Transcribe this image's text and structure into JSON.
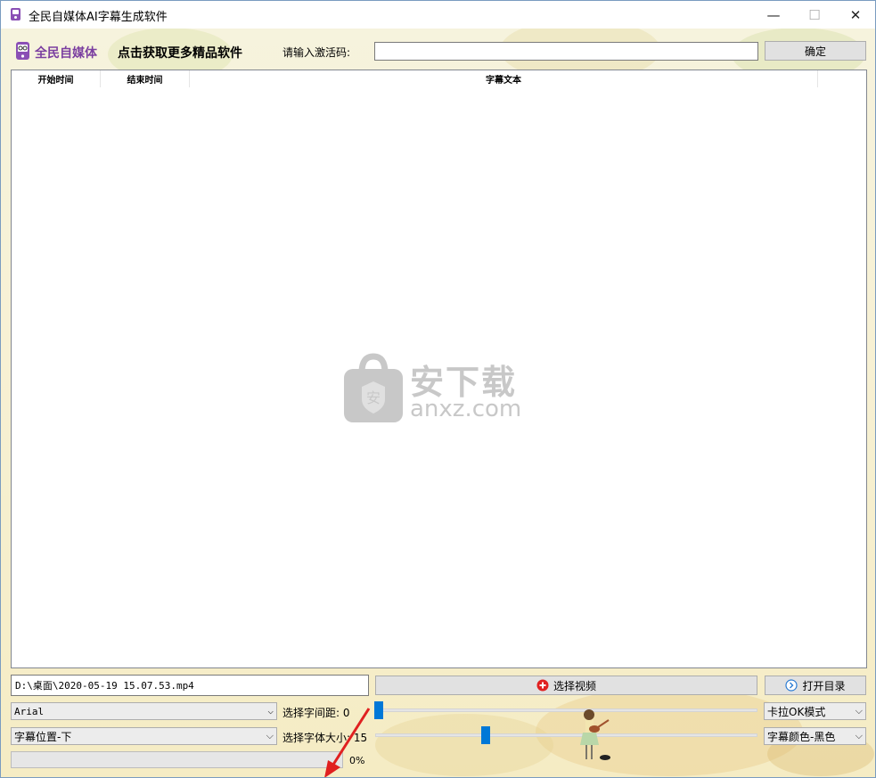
{
  "window": {
    "title": "全民自媒体AI字幕生成软件",
    "controls": {
      "minimize": "—",
      "maximize": "☐",
      "close": "✕"
    }
  },
  "header": {
    "brand": "全民自媒体",
    "promo_link": "点击获取更多精品软件",
    "activation_label": "请输入激活码:",
    "activation_value": "",
    "confirm_label": "确定"
  },
  "table": {
    "columns": [
      "开始时间",
      "结束时间",
      "字幕文本",
      ""
    ],
    "rows": []
  },
  "watermark": {
    "cn": "安下载",
    "en": "anxz.com"
  },
  "controls": {
    "video_path": "D:\\桌面\\2020-05-19 15.07.53.mp4",
    "select_video_label": "选择视频",
    "open_dir_label": "打开目录",
    "font_selected": "Arial",
    "position_selected": "字幕位置-下",
    "spacing_label": "选择字间距: 0",
    "spacing_value": 0,
    "size_label": "选择字体大小: 15",
    "size_value": 15,
    "mode_selected": "卡拉OK模式",
    "color_selected": "字幕颜色-黑色",
    "combo_arrow": "⌵"
  },
  "progress": {
    "value": 0,
    "text": "0%"
  },
  "colors": {
    "accent": "#0078d7",
    "brand_purple": "#7b3fa0",
    "select_icon_red": "#e02020",
    "annotation_arrow": "#e02020"
  },
  "icons": [
    "app-icon",
    "brand-logo-icon",
    "add-circle-icon",
    "chevron-right-circle-icon",
    "chevron-down-icon"
  ]
}
